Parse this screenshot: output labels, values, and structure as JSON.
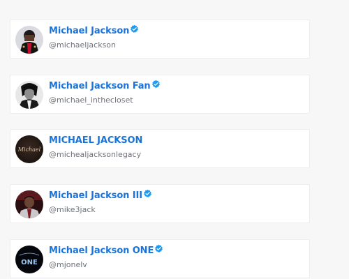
{
  "accounts": [
    {
      "name": "Michael Jackson",
      "handle": "@michaeljackson",
      "verified": true,
      "avatar_icon": "avatar-michael-jackson-photo"
    },
    {
      "name": "Michael Jackson Fan",
      "handle": "@michael_inthecloset",
      "verified": true,
      "avatar_icon": "avatar-bw-portrait-photo"
    },
    {
      "name": "MICHAEL JACKSON",
      "handle": "@michealjacksonlegacy",
      "verified": false,
      "avatar_icon": "avatar-signature-logo",
      "avatar_signature": "Michael"
    },
    {
      "name": "Michael Jackson III",
      "handle": "@mike3jack",
      "verified": true,
      "avatar_icon": "avatar-man-photo"
    },
    {
      "name": "Michael Jackson ONE",
      "handle": "@mjonelv",
      "verified": true,
      "avatar_icon": "avatar-one-logo",
      "avatar_logo_text": "ONE"
    }
  ],
  "colors": {
    "name": "#1a73d9",
    "handle": "#6d717a",
    "verified_badge": "#1d9bf0",
    "background": "#f7f7f8",
    "card": "#ffffff"
  }
}
